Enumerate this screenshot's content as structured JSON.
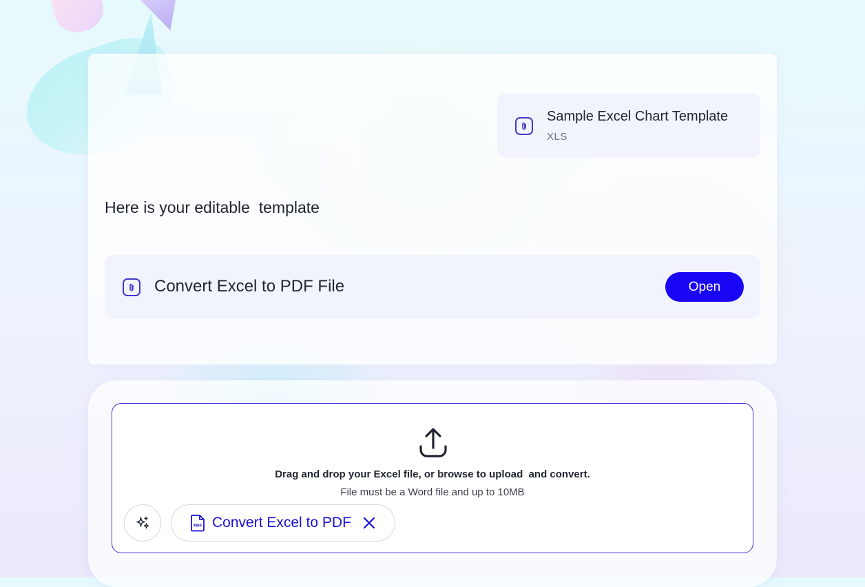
{
  "attachment": {
    "title": "Sample Excel Chart Template",
    "type": "XLS"
  },
  "response": {
    "text": "Here is your editable  template"
  },
  "result": {
    "title": "Convert Excel to PDF File",
    "open_label": "Open"
  },
  "upload": {
    "instruction": "Drag and drop your Excel file, or browse to upload  and convert.",
    "requirement": "File must be a Word file and up to 10MB"
  },
  "chip": {
    "label": "Convert Excel to PDF",
    "icon": "pdf-file-icon"
  },
  "colors": {
    "accent": "#1a06f5",
    "accent_text": "#1a10d6",
    "dropzone_border": "#3b2ee0",
    "card_bg": "#f1f4fd"
  }
}
